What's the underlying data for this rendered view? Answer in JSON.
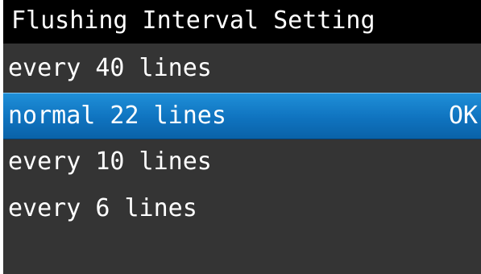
{
  "header": {
    "title": "Flushing Interval Setting"
  },
  "options": [
    {
      "label": "every 40 lines",
      "selected": false,
      "status": ""
    },
    {
      "label": "normal 22 lines",
      "selected": true,
      "status": "OK"
    },
    {
      "label": "every 10 lines",
      "selected": false,
      "status": ""
    },
    {
      "label": "every 6 lines",
      "selected": false,
      "status": ""
    }
  ],
  "colors": {
    "background": "#343434",
    "title_bar": "#000000",
    "selection": "#1479c4",
    "text": "#ffffff"
  }
}
